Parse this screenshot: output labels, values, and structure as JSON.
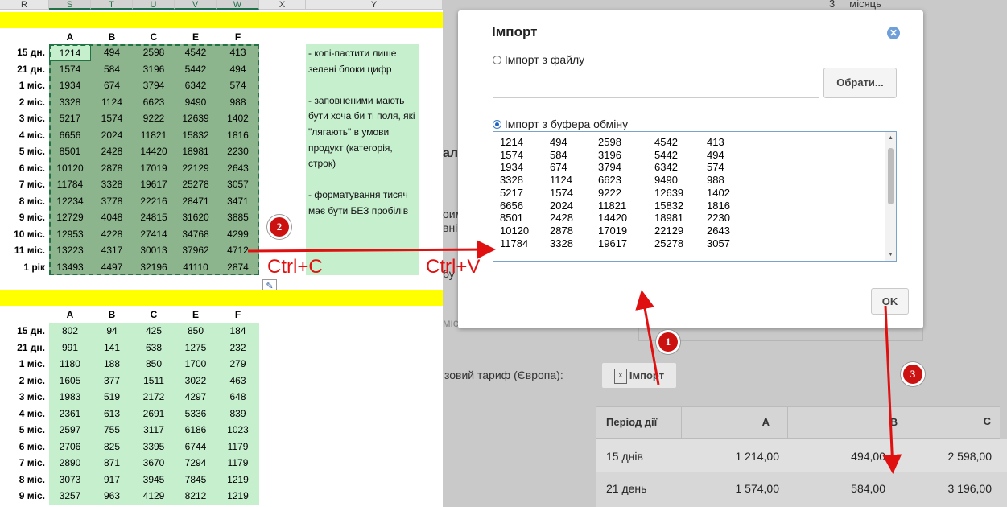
{
  "excel": {
    "col_headers": [
      "R",
      "S",
      "T",
      "U",
      "V",
      "W",
      "X",
      "Y"
    ],
    "table1": {
      "headers": [
        "A",
        "B",
        "C",
        "E",
        "F"
      ],
      "rows": [
        {
          "label": "15 дн.",
          "v": [
            "1214",
            "494",
            "2598",
            "4542",
            "413"
          ]
        },
        {
          "label": "21 дн.",
          "v": [
            "1574",
            "584",
            "3196",
            "5442",
            "494"
          ]
        },
        {
          "label": "1 міс.",
          "v": [
            "1934",
            "674",
            "3794",
            "6342",
            "574"
          ]
        },
        {
          "label": "2 міс.",
          "v": [
            "3328",
            "1124",
            "6623",
            "9490",
            "988"
          ]
        },
        {
          "label": "3 міс.",
          "v": [
            "5217",
            "1574",
            "9222",
            "12639",
            "1402"
          ]
        },
        {
          "label": "4 міс.",
          "v": [
            "6656",
            "2024",
            "11821",
            "15832",
            "1816"
          ]
        },
        {
          "label": "5 міс.",
          "v": [
            "8501",
            "2428",
            "14420",
            "18981",
            "2230"
          ]
        },
        {
          "label": "6 міс.",
          "v": [
            "10120",
            "2878",
            "17019",
            "22129",
            "2643"
          ]
        },
        {
          "label": "7 міс.",
          "v": [
            "11784",
            "3328",
            "19617",
            "25278",
            "3057"
          ]
        },
        {
          "label": "8 міс.",
          "v": [
            "12234",
            "3778",
            "22216",
            "28471",
            "3471"
          ]
        },
        {
          "label": "9 міс.",
          "v": [
            "12729",
            "4048",
            "24815",
            "31620",
            "3885"
          ]
        },
        {
          "label": "10 міс.",
          "v": [
            "12953",
            "4228",
            "27414",
            "34768",
            "4299"
          ]
        },
        {
          "label": "11 міс.",
          "v": [
            "13223",
            "4317",
            "30013",
            "37962",
            "4712"
          ]
        },
        {
          "label": "1 рік",
          "v": [
            "13493",
            "4497",
            "32196",
            "41110",
            "2874"
          ]
        }
      ]
    },
    "table2": {
      "headers": [
        "A",
        "B",
        "C",
        "E",
        "F"
      ],
      "rows": [
        {
          "label": "15 дн.",
          "v": [
            "802",
            "94",
            "425",
            "850",
            "184"
          ]
        },
        {
          "label": "21 дн.",
          "v": [
            "991",
            "141",
            "638",
            "1275",
            "232"
          ]
        },
        {
          "label": "1 міс.",
          "v": [
            "1180",
            "188",
            "850",
            "1700",
            "279"
          ]
        },
        {
          "label": "2 міс.",
          "v": [
            "1605",
            "377",
            "1511",
            "3022",
            "463"
          ]
        },
        {
          "label": "3 міс.",
          "v": [
            "1983",
            "519",
            "2172",
            "4297",
            "648"
          ]
        },
        {
          "label": "4 міс.",
          "v": [
            "2361",
            "613",
            "2691",
            "5336",
            "839"
          ]
        },
        {
          "label": "5 міс.",
          "v": [
            "2597",
            "755",
            "3117",
            "6186",
            "1023"
          ]
        },
        {
          "label": "6 міс.",
          "v": [
            "2706",
            "825",
            "3395",
            "6744",
            "1179"
          ]
        },
        {
          "label": "7 міс.",
          "v": [
            "2890",
            "871",
            "3670",
            "7294",
            "1179"
          ]
        },
        {
          "label": "8 міс.",
          "v": [
            "3073",
            "917",
            "3945",
            "7845",
            "1219"
          ]
        },
        {
          "label": "9 міс.",
          "v": [
            "3257",
            "963",
            "4129",
            "8212",
            "1219"
          ]
        }
      ]
    },
    "note": {
      "p1": "- копі-пастити лише зелені блоки цифр",
      "p2": "- заповненими мають бути хоча би ті поля, які \"лягають\" в умови продукт (категорія, строк)",
      "p3": "- форматування тисяч має бути БЕЗ пробілів"
    }
  },
  "web": {
    "top_fragment": "3     місяць",
    "side_fragments": [
      "ала",
      "оим",
      "внiц",
      "бу",
      "міс"
    ],
    "tariff_label": "зовий тариф (Європа):",
    "import_button": "Імпорт",
    "table": {
      "headers": [
        "Період дії",
        "A",
        "B",
        "C"
      ],
      "rows": [
        {
          "period": "15 днів",
          "a": "1 214,00",
          "b": "494,00",
          "c": "2 598,00"
        },
        {
          "period": "21 день",
          "a": "1 574,00",
          "b": "584,00",
          "c": "3 196,00"
        }
      ]
    }
  },
  "dialog": {
    "title": "Імпорт",
    "option_file": "Імпорт з файлу",
    "browse_button": "Обрати...",
    "option_clipboard": "Імпорт з буфера обміну",
    "ok_button": "OK",
    "paste_lines": [
      "1214\t494\t2598\t4542\t413",
      "1574\t584\t3196\t5442\t494",
      "1934\t674\t3794\t6342\t574",
      "3328\t1124\t6623\t9490\t988",
      "5217\t1574\t9222\t12639\t1402",
      "6656\t2024\t11821\t15832\t1816",
      "8501\t2428\t14420\t18981\t2230",
      "10120\t2878\t17019\t22129\t2643",
      "11784\t3328\t19617\t25278\t3057"
    ]
  },
  "annotations": {
    "ctrl_c": "Ctrl+C",
    "ctrl_v": "Ctrl+V",
    "badges": [
      "1",
      "2",
      "3"
    ]
  },
  "colors": {
    "highlight_yellow": "#ffff00",
    "light_green": "#c6efce",
    "selection_green": "#8db58d",
    "annotation_red": "#e01010"
  }
}
